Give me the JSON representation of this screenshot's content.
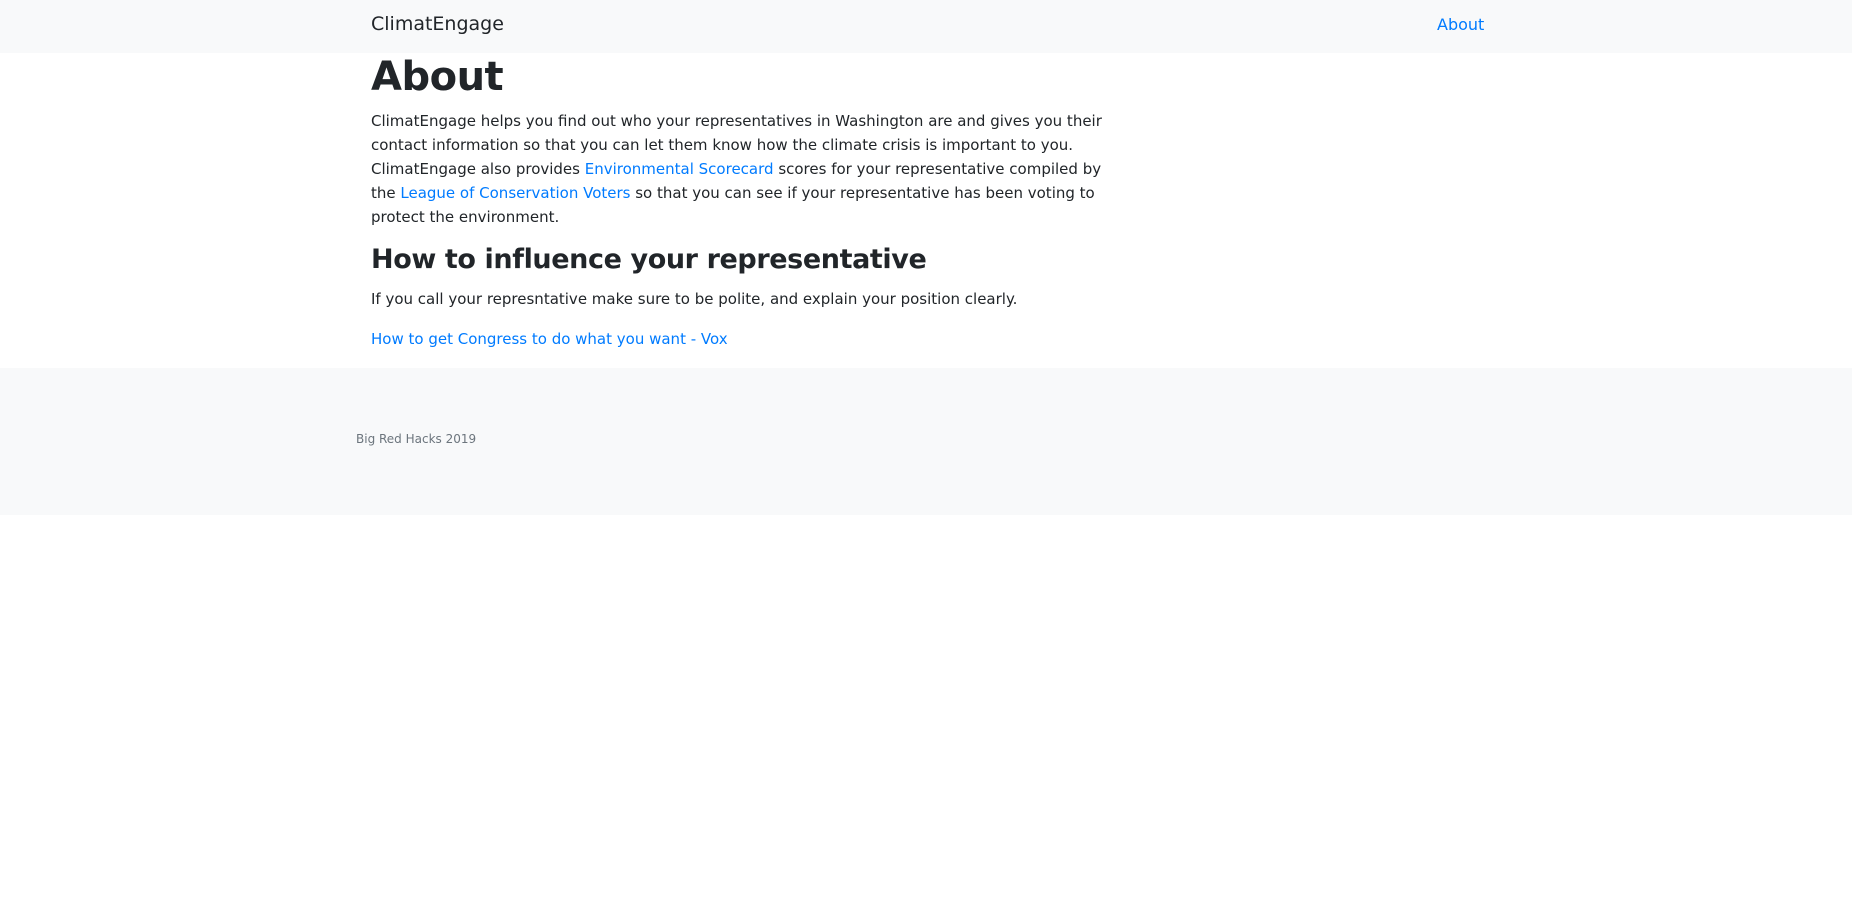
{
  "navbar": {
    "brand": "ClimatEngage",
    "about_link": "About"
  },
  "main": {
    "title": "About",
    "intro": {
      "part1": "ClimatEngage helps you find out who your representatives in Washington are and gives you their contact information so that you can let them know how the climate crisis is important to you. ClimatEngage also provides ",
      "scorecard_link": "Environmental Scorecard",
      "part2": " scores for your representative compiled by the ",
      "lcv_link": "League of Conservation Voters",
      "part3": " so that you can see if your representative has been voting to protect the environment."
    },
    "section_title": "How to influence your representative",
    "advice": "If you call your represntative make sure to be polite, and explain your position clearly.",
    "vox_link": "How to get Congress to do what you want - Vox"
  },
  "footer": {
    "text": "Big Red Hacks 2019"
  },
  "colors": {
    "link": "#007bff",
    "navbar_bg": "#f8f9fa",
    "text": "#212529",
    "muted": "#6c757d"
  }
}
